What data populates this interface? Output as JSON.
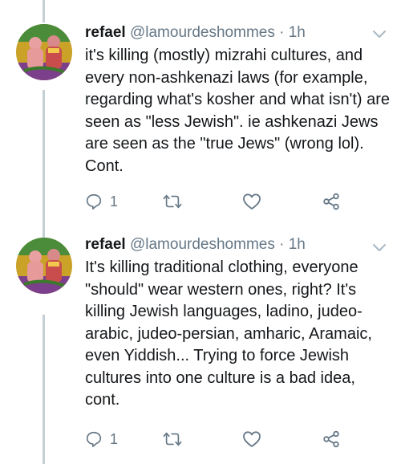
{
  "tweets": [
    {
      "author": {
        "name": "refael",
        "handle": "@lamourdeshommes",
        "separator": "·",
        "time": "1h"
      },
      "text": "it's killing (mostly) mizrahi cultures, and every non-ashkenazi laws (for example, regarding what's kosher and what isn't) are seen as \"less Jewish\". ie ashkenazi Jews are seen as the \"true Jews\" (wrong lol). Cont.",
      "reply_count": "1",
      "icons": {
        "reply": "reply-icon",
        "retweet": "retweet-icon",
        "like": "heart-icon",
        "share": "share-icon",
        "menu": "chevron-down-icon"
      }
    },
    {
      "author": {
        "name": "refael",
        "handle": "@lamourdeshommes",
        "separator": "·",
        "time": "1h"
      },
      "text": "It's killing traditional clothing, everyone \"should\" wear western ones, right? It's killing Jewish languages, ladino, judeo-arabic, judeo-persian, amharic, Aramaic, even Yiddish... Trying to force Jewish cultures into one culture is a bad idea, cont.",
      "reply_count": "1",
      "icons": {
        "reply": "reply-icon",
        "retweet": "retweet-icon",
        "like": "heart-icon",
        "share": "share-icon",
        "menu": "chevron-down-icon"
      }
    }
  ],
  "colors": {
    "text": "#14171a",
    "secondary": "#657786",
    "thread_line": "#c4cfd6",
    "icon": "#657786"
  }
}
